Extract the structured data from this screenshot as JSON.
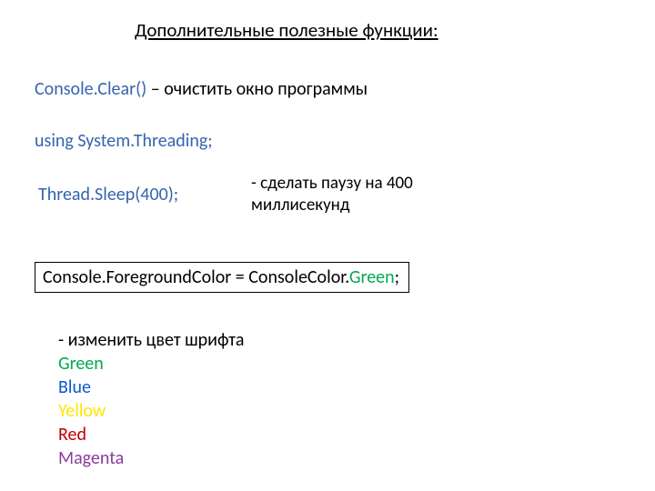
{
  "title": "Дополнительные полезные функции:",
  "line1": {
    "code": "Console.Clear()",
    "desc": " – очистить окно программы"
  },
  "line2": "using System.Threading;",
  "sleep": {
    "code": "Thread.Sleep(400);",
    "desc1": " - сделать паузу на 400",
    "desc2": "миллисекунд"
  },
  "boxed": {
    "prefix": "Console.ForegroundColor = ConsoleColor.",
    "green": "Green",
    "semicolon": ";"
  },
  "colors": {
    "intro": " - изменить цвет шрифта",
    "green": "Green",
    "blue": "Blue",
    "yellow": "Yellow",
    "red": "Red",
    "magenta": "Magenta"
  }
}
